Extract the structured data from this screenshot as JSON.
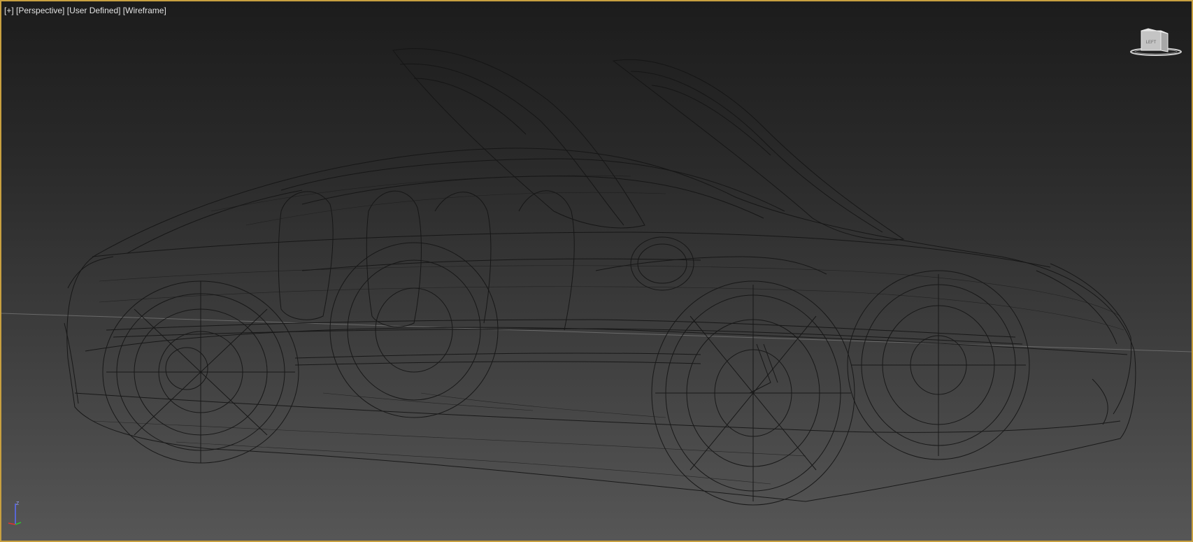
{
  "viewport": {
    "menu_plus": "[+]",
    "view_name": "[Perspective]",
    "shading_preset": "[User Defined]",
    "display_mode": "[Wireframe]"
  },
  "viewcube": {
    "face_label": "LEFT",
    "icon": "viewcube-icon"
  },
  "axis_tripod": {
    "z_label": "Z",
    "icon": "axis-tripod-icon"
  },
  "colors": {
    "active_viewport_border": "#c8a040",
    "wireframe": "#141414",
    "label_text": "#e2e2e2"
  }
}
